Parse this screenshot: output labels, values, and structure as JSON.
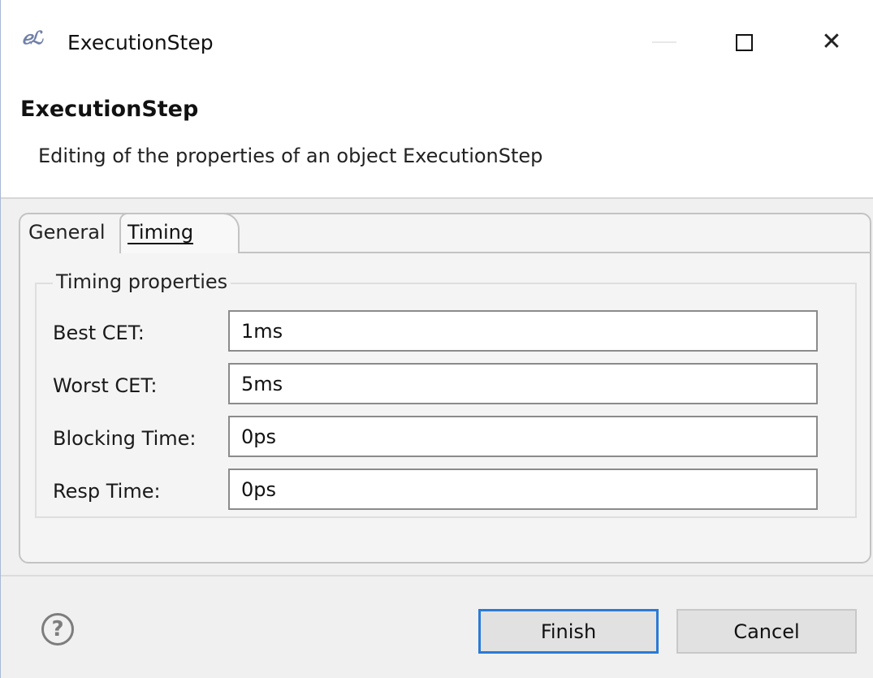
{
  "window": {
    "title": "ExecutionStep",
    "app_icon_text": "ℯℒ"
  },
  "header": {
    "title": "ExecutionStep",
    "description": "Editing of the properties of an object ExecutionStep"
  },
  "tabs": [
    {
      "label": "General",
      "selected": false
    },
    {
      "label": "Timing",
      "selected": true
    }
  ],
  "group": {
    "title": "Timing properties",
    "fields": [
      {
        "label": "Best CET:",
        "value": "1ms"
      },
      {
        "label": "Worst CET:",
        "value": "5ms"
      },
      {
        "label": "Blocking Time:",
        "value": "0ps"
      },
      {
        "label": "Resp Time:",
        "value": "0ps"
      }
    ]
  },
  "buttons": {
    "finish": "Finish",
    "cancel": "Cancel",
    "help": "?"
  },
  "colors": {
    "default_button_border": "#2b7ad6",
    "dialog_background": "#f0f0f0"
  }
}
